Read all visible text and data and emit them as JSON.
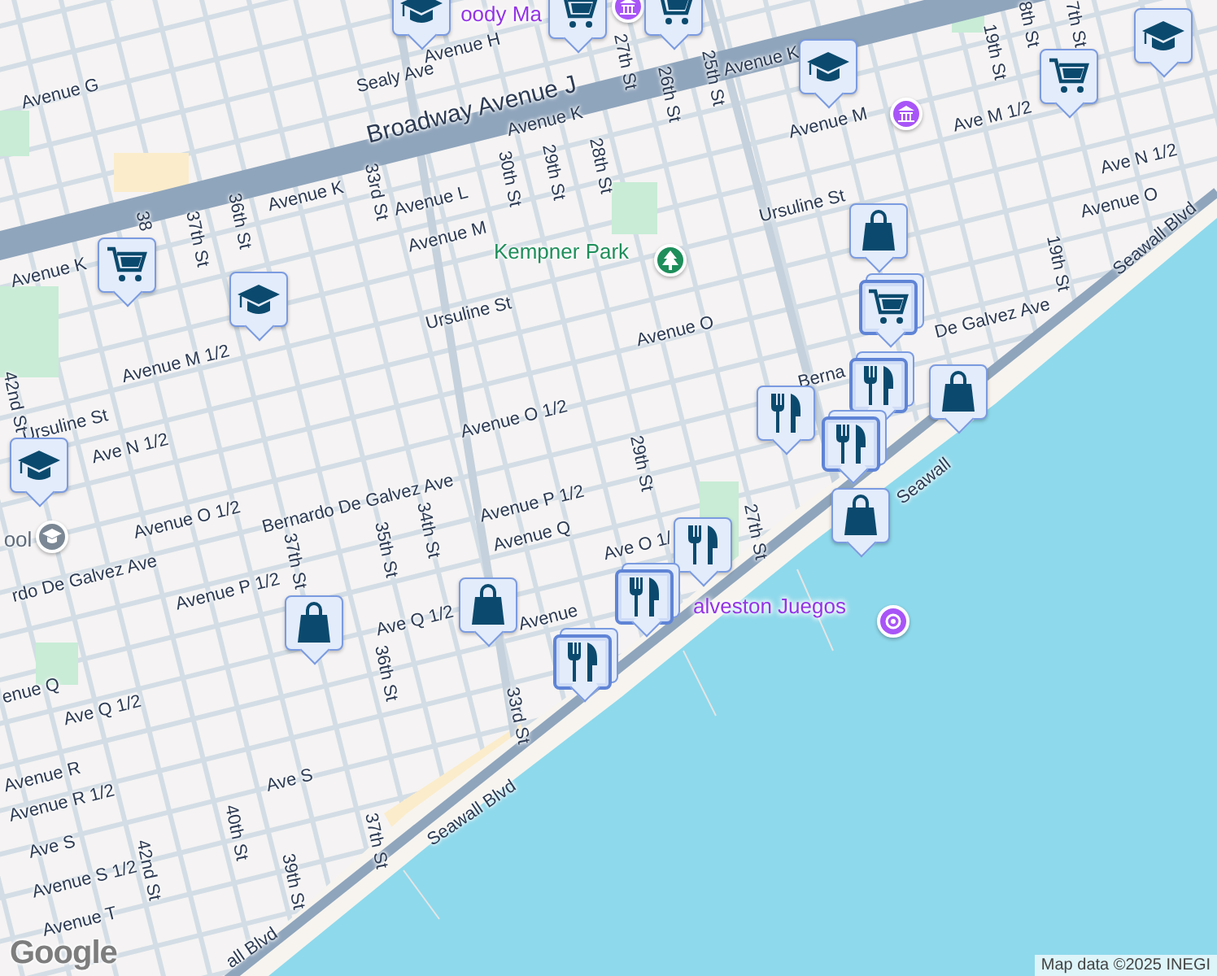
{
  "map": {
    "labels": [
      {
        "text": "Avenue H",
        "kind": "street"
      },
      {
        "text": "oody Ma",
        "kind": "poi"
      },
      {
        "text": "Sealy Ave",
        "kind": "street"
      },
      {
        "text": "Avenue G",
        "kind": "street"
      },
      {
        "text": "Broadway Avenue J",
        "kind": "highway"
      },
      {
        "text": "Avenue K",
        "kind": "street"
      },
      {
        "text": "27th St",
        "kind": "street"
      },
      {
        "text": "26th St",
        "kind": "street"
      },
      {
        "text": "25th St",
        "kind": "street"
      },
      {
        "text": "Avenue K",
        "kind": "street"
      },
      {
        "text": "28th St",
        "kind": "street"
      },
      {
        "text": "29th St",
        "kind": "street"
      },
      {
        "text": "30th St",
        "kind": "street"
      },
      {
        "text": "Avenue L",
        "kind": "street"
      },
      {
        "text": "Avenue M",
        "kind": "street"
      },
      {
        "text": "Avenue K",
        "kind": "street"
      },
      {
        "text": "33rd St",
        "kind": "street"
      },
      {
        "text": "36th St",
        "kind": "street"
      },
      {
        "text": "37th St",
        "kind": "street"
      },
      {
        "text": "38",
        "kind": "street"
      },
      {
        "text": "Avenue K",
        "kind": "street"
      },
      {
        "text": "Avenue M 1/2",
        "kind": "street"
      },
      {
        "text": "Ursuline St",
        "kind": "street"
      },
      {
        "text": "Kempner Park",
        "kind": "park"
      },
      {
        "text": "Avenue M",
        "kind": "street"
      },
      {
        "text": "Ursuline St",
        "kind": "street"
      },
      {
        "text": "19th St",
        "kind": "street"
      },
      {
        "text": "8th St",
        "kind": "street"
      },
      {
        "text": "7th St",
        "kind": "street"
      },
      {
        "text": "Ave M 1/2",
        "kind": "street"
      },
      {
        "text": "Ave N 1/2",
        "kind": "street"
      },
      {
        "text": "Avenue O",
        "kind": "street"
      },
      {
        "text": "19th St",
        "kind": "street"
      },
      {
        "text": "Seawall Blvd",
        "kind": "street"
      },
      {
        "text": "Avenue O",
        "kind": "street"
      },
      {
        "text": "Berna",
        "kind": "street"
      },
      {
        "text": "Avenue O 1/2",
        "kind": "street"
      },
      {
        "text": "29th St",
        "kind": "street"
      },
      {
        "text": "Ursuline St",
        "kind": "street"
      },
      {
        "text": "Ave N 1/2",
        "kind": "street"
      },
      {
        "text": "42nd St",
        "kind": "street"
      },
      {
        "text": "Avenue O 1/2",
        "kind": "street"
      },
      {
        "text": "Bernardo De Galvez Ave",
        "kind": "street"
      },
      {
        "text": "rdo De Galvez Ave",
        "kind": "street"
      },
      {
        "text": "Avenue P 1/2",
        "kind": "street"
      },
      {
        "text": "37th St",
        "kind": "street"
      },
      {
        "text": "35th St",
        "kind": "street"
      },
      {
        "text": "34th St",
        "kind": "street"
      },
      {
        "text": "Avenue P 1/2",
        "kind": "street"
      },
      {
        "text": "Avenue Q",
        "kind": "street"
      },
      {
        "text": "Ave Q 1/2",
        "kind": "street"
      },
      {
        "text": "Avenue",
        "kind": "street"
      },
      {
        "text": "Ave O 1/",
        "kind": "street"
      },
      {
        "text": "27th St",
        "kind": "street"
      },
      {
        "text": "alveston Juegos",
        "kind": "poi"
      },
      {
        "text": "enue Q",
        "kind": "street"
      },
      {
        "text": "Ave Q 1/2",
        "kind": "street"
      },
      {
        "text": "Avenue R",
        "kind": "street"
      },
      {
        "text": "Avenue R 1/2",
        "kind": "street"
      },
      {
        "text": "Ave S",
        "kind": "street"
      },
      {
        "text": "Ave S",
        "kind": "street"
      },
      {
        "text": "Avenue S 1/2",
        "kind": "street"
      },
      {
        "text": "Avenue T",
        "kind": "street"
      },
      {
        "text": "36th St",
        "kind": "street"
      },
      {
        "text": "33rd St",
        "kind": "street"
      },
      {
        "text": "40th St",
        "kind": "street"
      },
      {
        "text": "39th St",
        "kind": "street"
      },
      {
        "text": "37th St",
        "kind": "street"
      },
      {
        "text": "42nd St",
        "kind": "street"
      },
      {
        "text": "Seawall Blvd",
        "kind": "street"
      },
      {
        "text": "all Blvd",
        "kind": "street"
      },
      {
        "text": "Seawall",
        "kind": "street"
      },
      {
        "text": "ool",
        "kind": "school"
      },
      {
        "text": "De Galvez Ave",
        "kind": "street"
      }
    ],
    "markers": [
      {
        "kind": "school",
        "stacked": false
      },
      {
        "kind": "cart",
        "stacked": false
      },
      {
        "kind": "cart",
        "stacked": false
      },
      {
        "kind": "school",
        "stacked": false
      },
      {
        "kind": "cart",
        "stacked": false
      },
      {
        "kind": "school",
        "stacked": false
      },
      {
        "kind": "cart",
        "stacked": false
      },
      {
        "kind": "school",
        "stacked": false
      },
      {
        "kind": "school",
        "stacked": false
      },
      {
        "kind": "shop",
        "stacked": false
      },
      {
        "kind": "cart",
        "stacked": true
      },
      {
        "kind": "food",
        "stacked": false
      },
      {
        "kind": "food",
        "stacked": true
      },
      {
        "kind": "shop",
        "stacked": false
      },
      {
        "kind": "food",
        "stacked": true
      },
      {
        "kind": "shop",
        "stacked": false
      },
      {
        "kind": "food",
        "stacked": false
      },
      {
        "kind": "food",
        "stacked": true
      },
      {
        "kind": "food",
        "stacked": true
      },
      {
        "kind": "shop",
        "stacked": false
      },
      {
        "kind": "shop",
        "stacked": false
      }
    ],
    "places": [
      {
        "kind": "museum"
      },
      {
        "kind": "park"
      },
      {
        "kind": "school"
      },
      {
        "kind": "amusement"
      },
      {
        "kind": "museum"
      }
    ],
    "logo": "Google",
    "attribution": "Map data ©2025 INEGI"
  }
}
